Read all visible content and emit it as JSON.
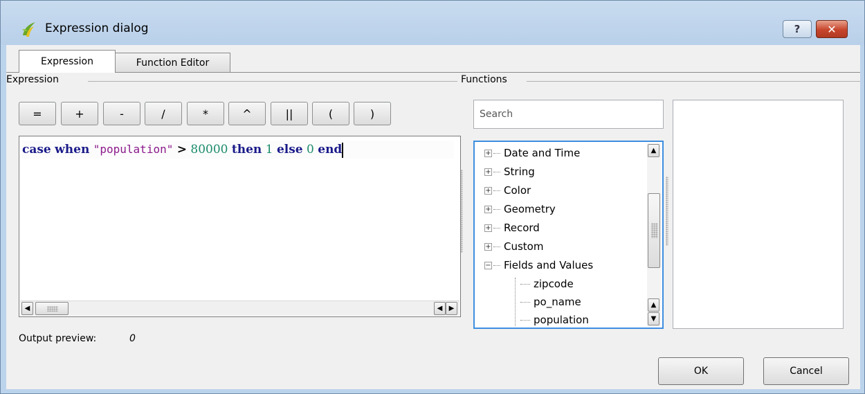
{
  "window": {
    "title": "Expression dialog",
    "help_label": "?",
    "close_label": "✕"
  },
  "tabs": [
    {
      "label": "Expression"
    },
    {
      "label": "Function Editor"
    }
  ],
  "expression_group": {
    "label": "Expression"
  },
  "functions_group": {
    "label": "Functions"
  },
  "operators": [
    "=",
    "+",
    "-",
    "/",
    "*",
    "^",
    "||",
    "(",
    ")"
  ],
  "editor": {
    "tokens": [
      {
        "text": "case",
        "kind": "kw"
      },
      {
        "text": " "
      },
      {
        "text": "when",
        "kind": "kw"
      },
      {
        "text": " "
      },
      {
        "text": "\"population\"",
        "kind": "str"
      },
      {
        "text": " "
      },
      {
        "text": ">",
        "kind": "op"
      },
      {
        "text": " "
      },
      {
        "text": "80000",
        "kind": "num"
      },
      {
        "text": " "
      },
      {
        "text": "then",
        "kind": "kw"
      },
      {
        "text": " "
      },
      {
        "text": "1",
        "kind": "num"
      },
      {
        "text": " "
      },
      {
        "text": "else",
        "kind": "kw"
      },
      {
        "text": " "
      },
      {
        "text": "0",
        "kind": "num"
      },
      {
        "text": " "
      },
      {
        "text": "end",
        "kind": "kw"
      }
    ]
  },
  "preview": {
    "label": "Output preview:",
    "value": "0"
  },
  "search": {
    "placeholder": "Search",
    "value": ""
  },
  "tree": {
    "groups": [
      {
        "label": "Date and Time",
        "expanded": false
      },
      {
        "label": "String",
        "expanded": false
      },
      {
        "label": "Color",
        "expanded": false
      },
      {
        "label": "Geometry",
        "expanded": false
      },
      {
        "label": "Record",
        "expanded": false
      },
      {
        "label": "Custom",
        "expanded": false
      },
      {
        "label": "Fields and Values",
        "expanded": true
      }
    ],
    "fields": [
      "zipcode",
      "po_name",
      "population"
    ]
  },
  "buttons": {
    "ok": "OK",
    "cancel": "Cancel"
  },
  "colors": {
    "keyword": "#1a1a8a",
    "string": "#8b1a8b",
    "number": "#1a8a6a",
    "focus": "#3d8ee0",
    "close": "#c6452c"
  },
  "icons": {
    "app": "qgis-icon",
    "help": "help-icon",
    "close": "close-icon",
    "expand": "plus-box-icon",
    "collapse": "minus-box-icon"
  }
}
